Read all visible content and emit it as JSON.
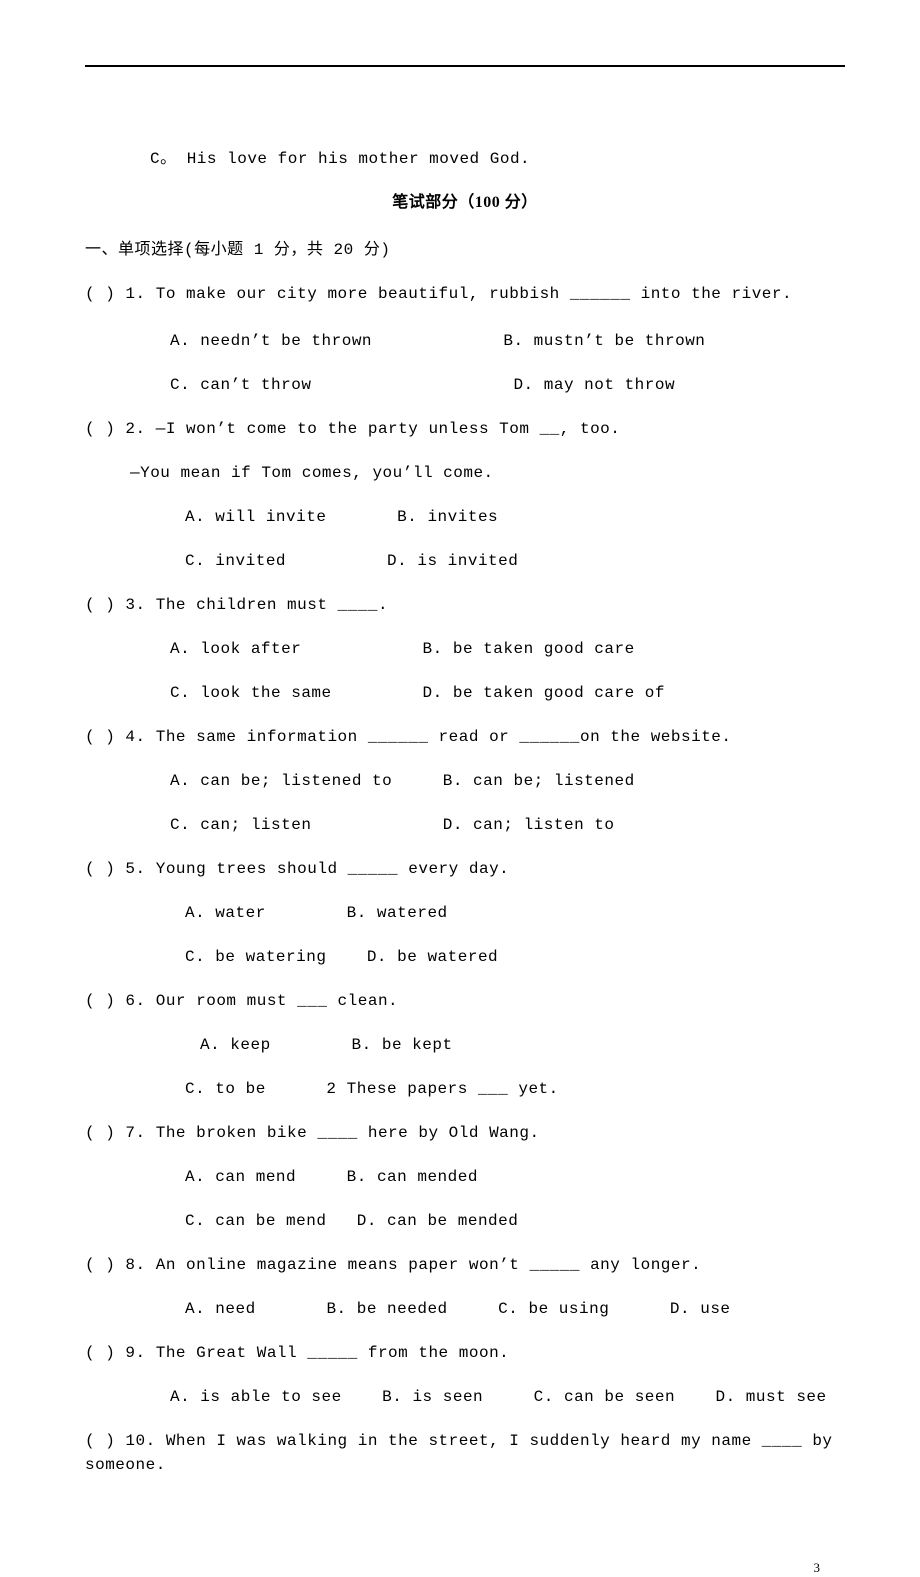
{
  "top_option_c": "C。 His love for his mother moved God.",
  "section_title": "笔试部分（100 分）",
  "section1_header": "一、单项选择(每小题 1 分，共 20 分)",
  "q1": {
    "prompt": "(    ) 1. To make our city more beautiful, rubbish ______ into the river.",
    "a": "A. needn’t be thrown",
    "b": "B. mustn’t be thrown",
    "c": "C. can’t throw",
    "d": "D. may not throw"
  },
  "q2": {
    "prompt": "(    ) 2. —I won’t come to the party unless Tom __, too.",
    "cont": "—You mean if Tom comes, you’ll come.",
    "a": "A. will invite",
    "b": "B. invites",
    "c": "C. invited",
    "d": "D. is invited"
  },
  "q3": {
    "prompt": "(    ) 3. The children must ____.",
    "a": "A. look after",
    "b": "B. be taken good care",
    "c": "C. look the same",
    "d": "D. be taken good care of"
  },
  "q4": {
    "prompt": "(      ) 4. The same information ______ read or ______on the website.",
    "a": "A. can be; listened to",
    "b": "B. can be; listened",
    "c": "C. can; listen",
    "d": "D. can; listen to"
  },
  "q5": {
    "prompt": "(    ) 5. Young trees should _____ every day.",
    "a": "A. water",
    "b": "B. watered",
    "c": "C. be watering",
    "d": "D. be watered"
  },
  "q6": {
    "prompt": "(    ) 6. Our room must ___ clean.",
    "a": "A. keep",
    "b": "B. be kept",
    "c": "C. to be",
    "cont": "2 These papers ___ yet."
  },
  "q7": {
    "prompt": "(    ) 7. The broken bike ____ here by Old Wang.",
    "a": "A. can mend",
    "b": "B. can mended",
    "c": "C. can be mend",
    "d": "D. can be mended"
  },
  "q8": {
    "prompt": "(    ) 8. An online magazine means paper won’t _____ any longer.",
    "a": "A. need",
    "b": "B. be needed",
    "c": "C. be using",
    "d": "D. use"
  },
  "q9": {
    "prompt": "(    ) 9. The Great Wall _____ from the moon.",
    "a": "A. is able to see",
    "b": "B. is seen",
    "c": "C. can be seen",
    "d": "D. must see"
  },
  "q10": {
    "prompt": "(    ) 10. When I was walking in the street, I suddenly heard my name ____ by someone."
  },
  "page_number": "3"
}
